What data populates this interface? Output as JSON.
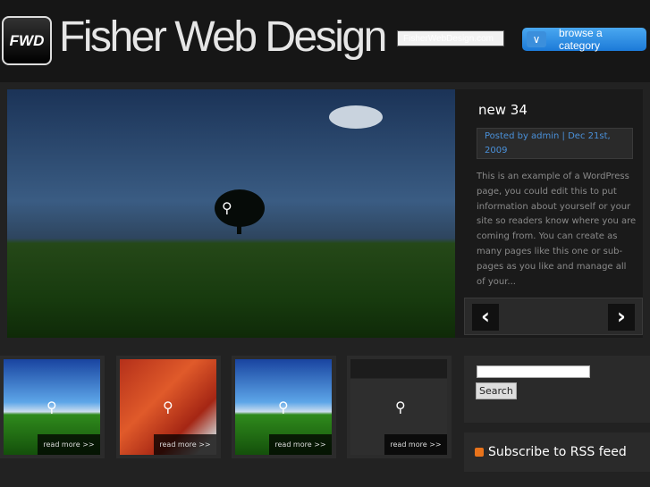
{
  "header": {
    "logo_badge": "FWD",
    "logo_text": "Fisher Web Design",
    "site_input_value": "FisherWebDesign.com",
    "category_button": "browse a category"
  },
  "featured": {
    "title": "new 34",
    "meta": "Posted by admin | Dec 21st, 2009",
    "excerpt": "This is an example of a WordPress page, you could edit this to put information about yourself or your site so readers know where you are coming from. You can create as many pages like this one or sub-pages as you like and manage all of your..."
  },
  "thumbs": [
    {
      "read_more": "read more >>"
    },
    {
      "read_more": "read more >>"
    },
    {
      "read_more": "read more >>"
    },
    {
      "read_more": "read more >>"
    }
  ],
  "sidebar": {
    "search_button": "Search",
    "rss_label": "Subscribe to RSS feed"
  }
}
